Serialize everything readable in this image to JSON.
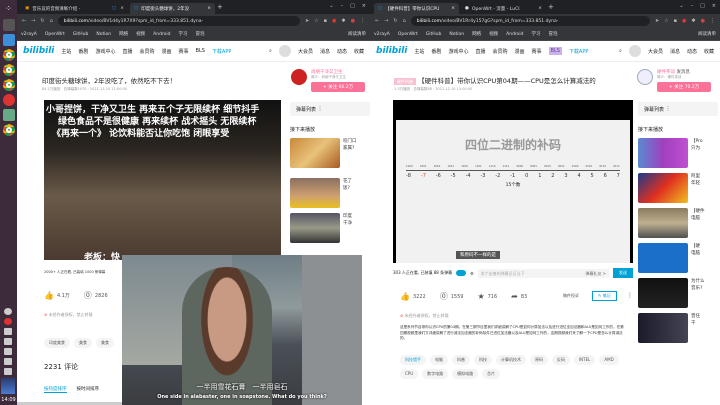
{
  "taskbar": {
    "clock": "14:09"
  },
  "left": {
    "tabs": [
      {
        "label": "音乐竞的音频清晰介绍 -"
      },
      {
        "label": ""
      },
      {
        "label": "印度街头糖球饼，2年没"
      }
    ],
    "url_host": "bilibili.com",
    "url_path": "/video/BV1d4y1R7X9?spm_id_from=333.851.dyna-",
    "bookmarks": [
      "v2rayA",
      "OpenWrt",
      "GitHub",
      "Notion",
      "网络",
      "视频",
      "Android",
      "学习",
      "冒泡"
    ],
    "reading_list": "阅读清单",
    "nav": [
      "主站",
      "番剧",
      "游戏中心",
      "直播",
      "会员购",
      "漫画",
      "赛事",
      "BLS",
      "下载APP"
    ],
    "nav_right": [
      "大会员",
      "消息",
      "动态",
      "收藏"
    ],
    "title": "印度街头糖球饼，2年没吃了，依然吃不下去！",
    "meta": "84.1万播放 · 总弹幕数1070 · 2021-12-10 11:00:00",
    "up_name": "尚朋干净又卫生",
    "up_desc": "简介：尚朋干净又卫生",
    "follow": "+ 关注 66.2万",
    "danmaku_list": "弹幕列表",
    "next_play": "接下来播放",
    "recs": [
      {
        "t": "咬门口\n家属?"
      },
      {
        "t": "花了\n饭? "
      },
      {
        "t": "印度\n干净"
      }
    ],
    "danmaku": [
      "小哥捏饼，干净又卫生 再来五个子无限续杯 细节抖手",
      "绿色食品不是很健康 再来续杯 战术摇头 无限续杯",
      "《再来一个》 论饮料能否让你吃饱 闭眼享受"
    ],
    "dm_bottom": "老板：快",
    "viewers": "2000+ 人正在看, 已装填 1000 条弹幕",
    "likes": "4.1万",
    "coins": "2826",
    "warn": "未经作者授权，禁止转载",
    "tags": [
      "印度美食",
      "美食",
      "美食"
    ],
    "comments_count": "2231",
    "comments_label": "评论",
    "sort_hot": "按热度排序",
    "sort_time": "按时间排序"
  },
  "right": {
    "tabs": [
      {
        "label": "【硬件科普】带你认识CPU"
      },
      {
        "label": "OpenWrt - 流量 - LuCI"
      }
    ],
    "url_host": "bilibili.com",
    "url_path": "/video/BV1Rr4y157gG?spm_id_from=333.851.dyna-",
    "badge": "硬件科普",
    "title": "【硬件科普】带你认识CPU第04期——CPU是怎么计算减法的",
    "meta": "1.3万播放 · 总弹幕数88 · 2021-12-10 12:00:00",
    "up_name": "硬件茶谈",
    "up_msg": "发消息",
    "up_desc": "简介：硬件茶谈",
    "follow": "+ 关注 70.2万",
    "slide_title": "四位二进制的补码",
    "binary": [
      "1000",
      "1001",
      "1010",
      "1011",
      "1100",
      "1101",
      "1110",
      "1111",
      "0000",
      "0001",
      "0010",
      "0011",
      "0100",
      "0101",
      "0110",
      "0111"
    ],
    "decimal": [
      "-8",
      "-7",
      "-6",
      "-5",
      "-4",
      "-3",
      "-2",
      "-1",
      "0",
      "1",
      "2",
      "3",
      "4",
      "5",
      "6",
      "7"
    ],
    "count_label": "15个数",
    "caption": "和原码不一样的是",
    "viewers": "303 人正在看, 已装填 88 条弹幕",
    "dm_placeholder": "发个友善的弹幕见证当下",
    "dm_etiquette": "弹幕礼仪 >",
    "send": "发送",
    "likes": "3222",
    "coins": "1559",
    "favs": "716",
    "shares": "83",
    "report": "稿件投诉",
    "notes": "笔记",
    "warn": "未经作者授权，禁止转载",
    "desc": "这是系列节目带你认识CPU的第04期。在第三期节目里我们详细讲解了CPU是如何计算加法以及进行进位全加法器和ALU是如何工作的。在第四期视频里我们又详细讲解了进行减法加法器的补码除件已进位加法器以及ALU是如何工作的，这期视频我们来了解一下CPU是怎么计算减法的。",
    "tags": [
      "科技猎手",
      "电脑",
      "科普",
      "科技",
      "计算机技术",
      "原码",
      "反码",
      "INTEL",
      "AMD",
      "CPU",
      "数字电路",
      "模拟电路",
      "芯片"
    ],
    "danmaku_list": "弹幕列表",
    "next_play": "接下来播放",
    "recs": [
      {
        "t": "【Pro\n只为"
      },
      {
        "t": "阿里\n年轻"
      },
      {
        "t": "【硬件\n电脑"
      },
      {
        "t": "【硬\n电脑"
      },
      {
        "t": "为什么\n音乐?"
      },
      {
        "t": "曾任\n干"
      }
    ]
  },
  "pip": {
    "sub_zh": "一半用雪花石膏　一半用皂石",
    "sub_en": "One side in alabaster, one in soapstone. What do you think?"
  }
}
